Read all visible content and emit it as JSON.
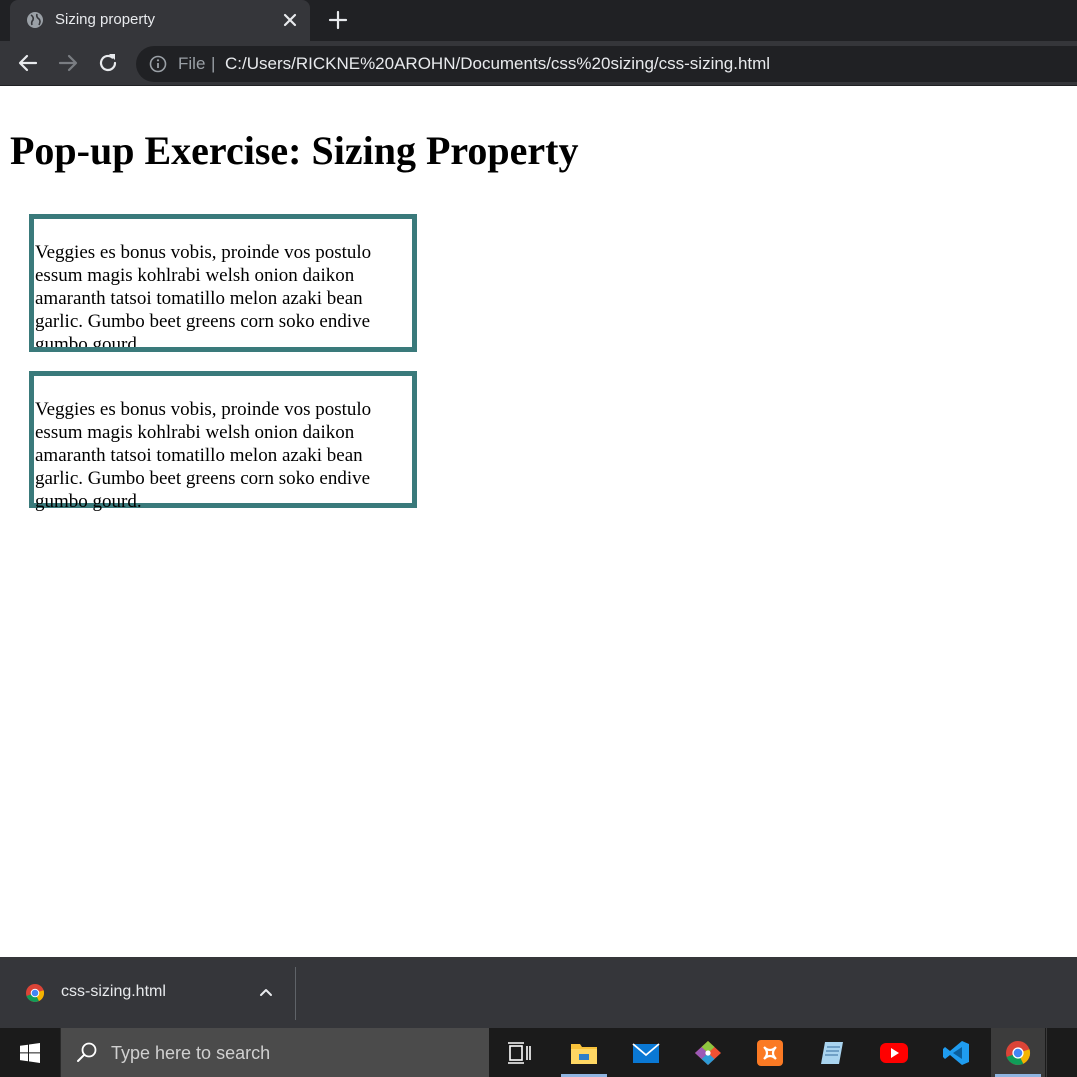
{
  "browser": {
    "tab": {
      "title": "Sizing property"
    },
    "address": {
      "scheme": "File",
      "separator": "|",
      "url": "C:/Users/RICKNE%20AROHN/Documents/css%20sizing/css-sizing.html"
    }
  },
  "page": {
    "heading": "Pop-up Exercise: Sizing Property",
    "boxes": [
      {
        "text": "Veggies es bonus vobis, proinde vos postulo essum magis kohlrabi welsh onion daikon amaranth tatsoi tomatillo melon azaki bean garlic. Gumbo beet greens corn soko endive gumbo gourd."
      },
      {
        "text": "Veggies es bonus vobis, proinde vos postulo essum magis kohlrabi welsh onion daikon amaranth tatsoi tomatillo melon azaki bean garlic. Gumbo beet greens corn soko endive gumbo gourd."
      }
    ],
    "box_border_color": "#3a7a7b"
  },
  "downloads": {
    "file_name": "css-sizing.html"
  },
  "taskbar": {
    "search_placeholder": "Type here to search",
    "apps": [
      "task-view",
      "file-explorer",
      "mail",
      "git",
      "xampp",
      "notepad",
      "youtube",
      "vscode",
      "chrome"
    ]
  }
}
